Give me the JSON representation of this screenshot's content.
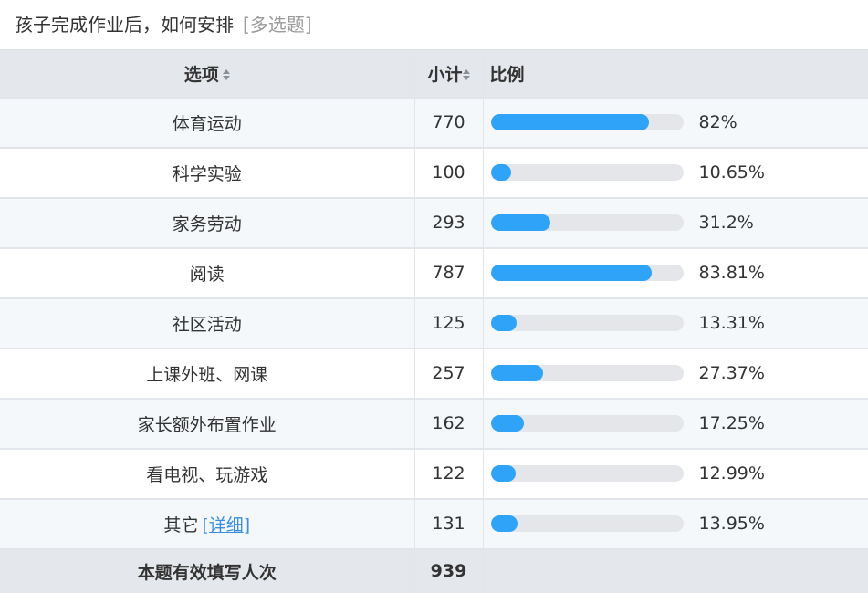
{
  "question": {
    "title": "孩子完成作业后，如何安排",
    "type_tag": "[多选题]"
  },
  "header": {
    "option": "选项",
    "count": "小计",
    "ratio": "比例"
  },
  "rows": [
    {
      "option": "体育运动",
      "count": "770",
      "percent": "82%",
      "fraction": 0.82
    },
    {
      "option": "科学实验",
      "count": "100",
      "percent": "10.65%",
      "fraction": 0.1065
    },
    {
      "option": "家务劳动",
      "count": "293",
      "percent": "31.2%",
      "fraction": 0.312
    },
    {
      "option": "阅读",
      "count": "787",
      "percent": "83.81%",
      "fraction": 0.8381
    },
    {
      "option": "社区活动",
      "count": "125",
      "percent": "13.31%",
      "fraction": 0.1331
    },
    {
      "option": "上课外班、网课",
      "count": "257",
      "percent": "27.37%",
      "fraction": 0.2737
    },
    {
      "option": "家长额外布置作业",
      "count": "162",
      "percent": "17.25%",
      "fraction": 0.1725
    },
    {
      "option": "看电视、玩游戏",
      "count": "122",
      "percent": "12.99%",
      "fraction": 0.1299
    },
    {
      "option": "其它",
      "detail_link": "[详细]",
      "count": "131",
      "percent": "13.95%",
      "fraction": 0.1395
    }
  ],
  "footer": {
    "label": "本题有效填写人次",
    "total": "939"
  },
  "colors": {
    "bar_fill": "#2fa3f7",
    "bar_track": "#e4e6ea",
    "header_bg": "#e4e7ec",
    "link": "#3b8fe0"
  }
}
